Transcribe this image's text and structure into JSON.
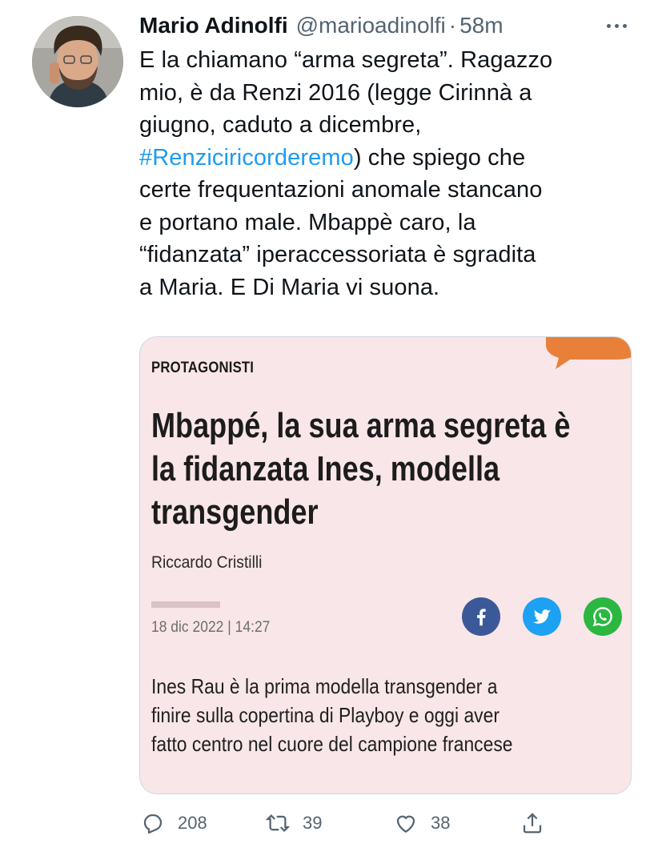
{
  "tweet": {
    "author_name": "Mario Adinolfi",
    "handle": "@marioadinolfi",
    "separator": "·",
    "time": "58m",
    "text_lines": [
      "E la chiamano “arma segreta”. Ragazzo",
      "mio, è da Renzi 2016 (legge Cirinnà a",
      "giugno, caduto a dicembre,",
      "",
      "certe frequentazioni anomale stancano",
      "e portano male. Mbappè caro, la",
      "“fidanzata” iperaccessoriata è sgradita",
      "a Maria. E Di Maria vi suona."
    ],
    "hashtag": "#Renziciricorderemo",
    "hashtag_suffix": ") che spiego che"
  },
  "card": {
    "kicker": "PROTAGONISTI",
    "headline": "Mbappé, la sua arma segreta è la fidanzata Ines, modella transgender",
    "author": "Riccardo Cristilli",
    "date": "18 dic 2022 | 14:27",
    "summary_lines": [
      "Ines Rau è la prima modella transgender a",
      "finire sulla copertina di Playboy e oggi aver",
      "fatto centro nel cuore del campione francese"
    ],
    "share_icons": [
      "facebook-icon",
      "twitter-icon",
      "whatsapp-icon"
    ]
  },
  "actions": {
    "replies": "208",
    "retweets": "39",
    "likes": "38"
  },
  "colors": {
    "link": "#1d9bf0",
    "muted": "#536471",
    "card_bg": "#f9e6e8",
    "bubble": "#e8803a"
  }
}
